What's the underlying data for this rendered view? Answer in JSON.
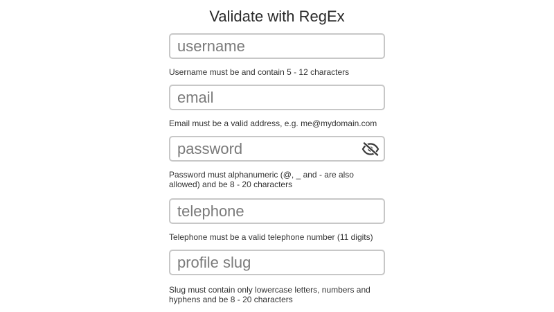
{
  "page": {
    "title": "Validate with RegEx"
  },
  "fields": {
    "username": {
      "placeholder": "username",
      "value": "",
      "hint": "Username must be and contain 5 - 12 characters"
    },
    "email": {
      "placeholder": "email",
      "value": "",
      "hint": "Email must be a valid address, e.g. me@mydomain.com"
    },
    "password": {
      "placeholder": "password",
      "value": "",
      "hint": "Password must alphanumeric (@, _ and - are also allowed) and be 8 - 20 characters",
      "toggle_icon": "eye-slash-icon"
    },
    "telephone": {
      "placeholder": "telephone",
      "value": "",
      "hint": "Telephone must be a valid telephone number (11 digits)"
    },
    "slug": {
      "placeholder": "profile slug",
      "value": "",
      "hint": "Slug must contain only lowercase letters, numbers and hyphens and be 8 - 20 characters"
    }
  },
  "colors": {
    "input_border": "#c7c7c7",
    "placeholder": "#7a7a7a",
    "text": "#333333"
  }
}
